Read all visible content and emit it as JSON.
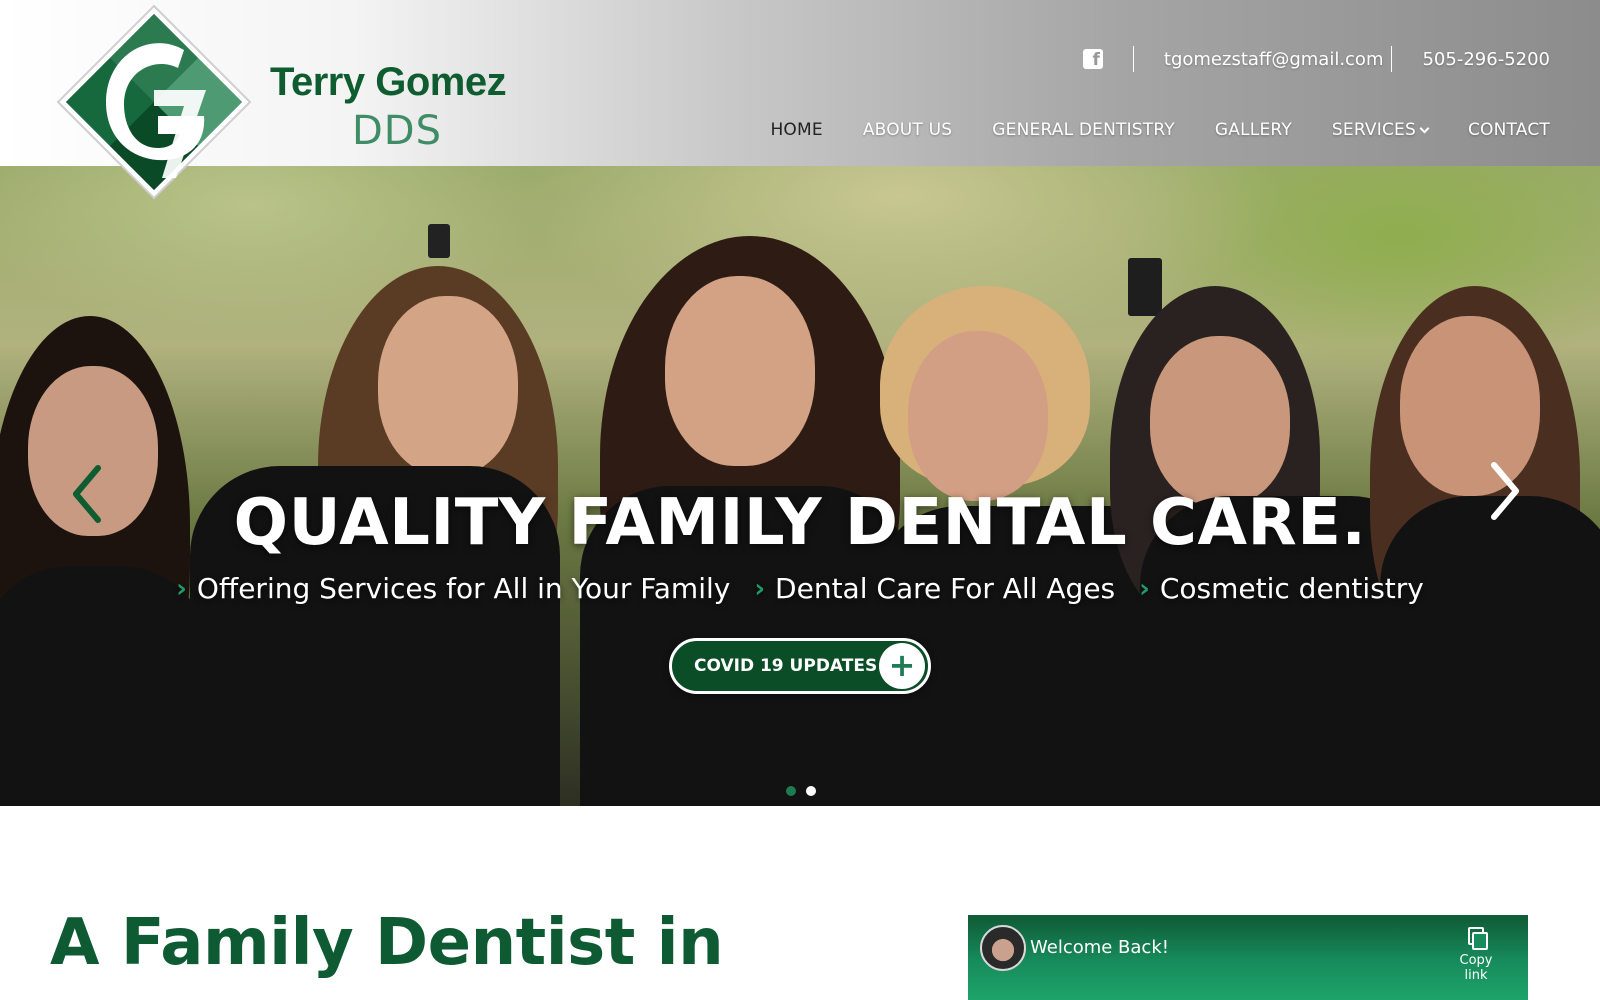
{
  "brand": {
    "name": "Terry Gomez",
    "suffix": "DDS",
    "logo_icon": "terry-gomez-logo-icon",
    "colors": {
      "brand_dark_green": "#0e5c2f",
      "brand_light_green": "#3f8d67",
      "accent_green": "#1e9b6a"
    }
  },
  "topbar": {
    "facebook_icon": "facebook-icon",
    "email": "tgomezstaff@gmail.com",
    "phone": "505-296-5200"
  },
  "nav": {
    "items": [
      {
        "label": "HOME",
        "active": true
      },
      {
        "label": "ABOUT US",
        "active": false
      },
      {
        "label": "GENERAL DENTISTRY",
        "active": false
      },
      {
        "label": "GALLERY",
        "active": false
      },
      {
        "label": "SERVICES",
        "active": false,
        "has_dropdown": true
      },
      {
        "label": "CONTACT",
        "active": false
      }
    ]
  },
  "hero": {
    "title": "QUALITY FAMILY DENTAL CARE.",
    "bullets": [
      "Offering Services for All in Your Family",
      "Dental Care For All Ages",
      "Cosmetic dentistry"
    ],
    "cta_label": "COVID 19 UPDATES",
    "cta_icon": "plus-icon",
    "prev_icon": "chevron-left-icon",
    "next_icon": "chevron-right-icon",
    "slides": {
      "count": 2,
      "active_index": 0
    }
  },
  "main": {
    "heading": "A Family Dentist in"
  },
  "widget": {
    "title": "Welcome Back!",
    "copy_label": "Copy link",
    "copy_icon": "copy-icon",
    "avatar_icon": "avatar"
  }
}
